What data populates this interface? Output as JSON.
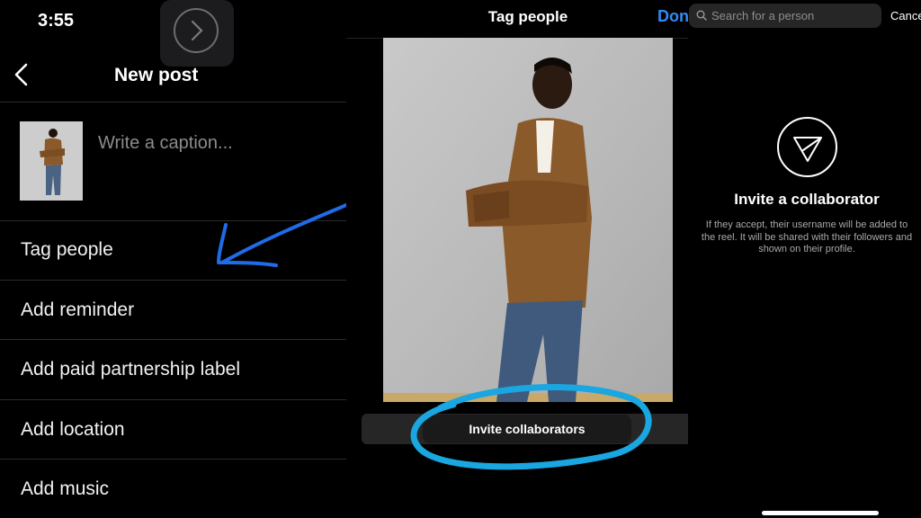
{
  "new_post": {
    "status_time": "3:55",
    "title": "New post",
    "caption_placeholder": "Write a caption...",
    "menu": [
      "Tag people",
      "Add reminder",
      "Add paid partnership label",
      "Add location",
      "Add music"
    ]
  },
  "tag_people": {
    "title": "Tag people",
    "done_label": "Don",
    "invite_button": "Invite collaborators"
  },
  "collaborator": {
    "search_placeholder": "Search for a person",
    "cancel_label": "Cance",
    "heading": "Invite a collaborator",
    "description": "If they accept, their username will be added to the reel. It will be shared with their followers and shown on their profile."
  },
  "colors": {
    "accent": "#2f8cf6",
    "annotation_blue": "#1f6be8",
    "annotation_cyan": "#1aa6e0"
  },
  "icons": [
    "chevron-right-icon",
    "back-arrow-icon",
    "search-icon",
    "send-icon"
  ]
}
